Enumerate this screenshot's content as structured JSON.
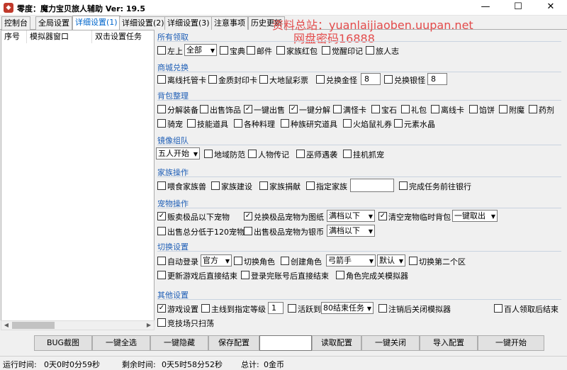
{
  "window": {
    "title": "零度：魔力宝贝旅人辅助 Ver:  19.5",
    "icon": "game-app-icon"
  },
  "watermark": {
    "line1": "资料总站：yuanlaijiaoben.uupan.net",
    "line2": "网盘密码16888",
    "color": "#e34b4b"
  },
  "tabs": [
    "控制台",
    "全局设置",
    "详细设置(1)",
    "详细设置(2)",
    "详细设置(3)",
    "注意事项",
    "历史更新"
  ],
  "left_panel": {
    "columns": [
      "序号",
      "模拟器窗口",
      "双击设置任务"
    ]
  },
  "groups": {
    "all_claim": {
      "title": "所有领取",
      "items": [
        "左上",
        "宝典",
        "邮件",
        "家族红包",
        "觉醒印记",
        "旅人志"
      ],
      "select": "全部"
    },
    "shop": {
      "title": "商城兑换",
      "items": [
        "离线托管卡",
        "金质封印卡",
        "大地鼠彩票",
        "兑换金怪",
        "兑换银怪"
      ],
      "gold_qty": "8",
      "silver_qty": "8"
    },
    "bag": {
      "title": "背包整理",
      "row1": [
        "分解装备",
        "出售饰品",
        "一键出售",
        "一键分解",
        "满怪卡",
        "宝石",
        "礼包",
        "离线卡",
        "馅饼",
        "附魔",
        "药剂"
      ],
      "row2": [
        "骑宠",
        "技能道具",
        "各种料理",
        "种族研究道具",
        "火焰鼠礼券",
        "元素水晶"
      ]
    },
    "mirror": {
      "title": "镜像组队",
      "select": "五人开始",
      "items": [
        "地域防范",
        "人物传记",
        "巫师遇袭",
        "挂机抓宠"
      ]
    },
    "family": {
      "title": "家族操作",
      "items": [
        "喂食家族兽",
        "家族建设",
        "家族捐献",
        "指定家族",
        "完成任务前往银行"
      ]
    },
    "pet": {
      "title": "宠物操作",
      "row1": [
        "贩卖极品以下宠物",
        "兑换极品宠物为图纸",
        "清空宠物临时背包"
      ],
      "row1_sel1": "满档以下",
      "row1_sel2": "一键取出",
      "row2": [
        "出售总分低于120宠物",
        "出售极品宠物为银币"
      ],
      "row2_sel": "满档以下"
    },
    "switch": {
      "title": "切换设置",
      "row1": [
        "自动登录",
        "切换角色",
        "创建角色",
        "切换第二个区"
      ],
      "login_sel": "官方",
      "class_sel": "弓箭手",
      "default_sel": "默认",
      "row2": [
        "更新游戏后直接结束",
        "登录完账号后直接结束",
        "角色完成关模拟器"
      ]
    },
    "other": {
      "title": "其他设置",
      "row1": [
        "游戏设置",
        "主线到指定等级",
        "活跃到",
        "注销后关闭模拟器",
        "百人领取后结束"
      ],
      "level": "1",
      "active_sel": "80结束任务",
      "row2": [
        "竞技场只扫荡"
      ]
    }
  },
  "buttons": [
    "BUG截图",
    "一键全选",
    "一键隐藏",
    "保存配置",
    "读取配置",
    "一键关闭",
    "导入配置",
    "一键开始"
  ],
  "status": {
    "run_label": "运行时间:",
    "run_value": "0天0时0分59秒",
    "left_label": "剩余时间:",
    "left_value": "0天5时58分52秒",
    "total_label": "总计:",
    "total_value": "0金币"
  }
}
